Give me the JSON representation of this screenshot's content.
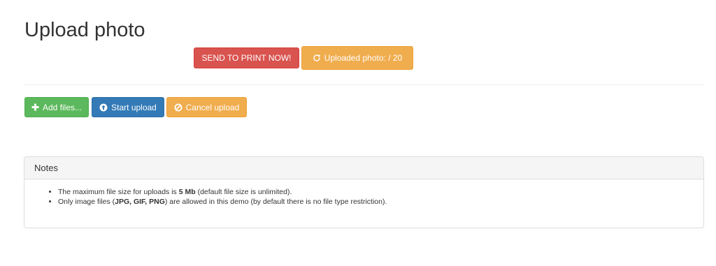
{
  "page": {
    "title": "Upload photo"
  },
  "actions": {
    "send_to_print_label": "SEND TO PRINT NOW!",
    "uploaded_label": "Uploaded photo: / 20"
  },
  "toolbar": {
    "add_files_label": "Add files...",
    "start_upload_label": "Start upload",
    "cancel_upload_label": "Cancel upload"
  },
  "notes": {
    "heading": "Notes",
    "item1": {
      "text_before": "The maximum file size for uploads is ",
      "bold": "5 Mb",
      "text_after": " (default file size is unlimited)."
    },
    "item2": {
      "text_before": "Only image files (",
      "bold": "JPG, GIF, PNG",
      "text_after": ") are allowed in this demo (by default there is no file type restriction)."
    }
  },
  "colors": {
    "danger": "#d9534f",
    "warning": "#f0ad4e",
    "success": "#5cb85c",
    "primary": "#337ab7"
  },
  "icons": {
    "uploaded": "refresh-icon",
    "add": "plus-icon",
    "start": "upload-icon",
    "cancel": "ban-icon"
  }
}
